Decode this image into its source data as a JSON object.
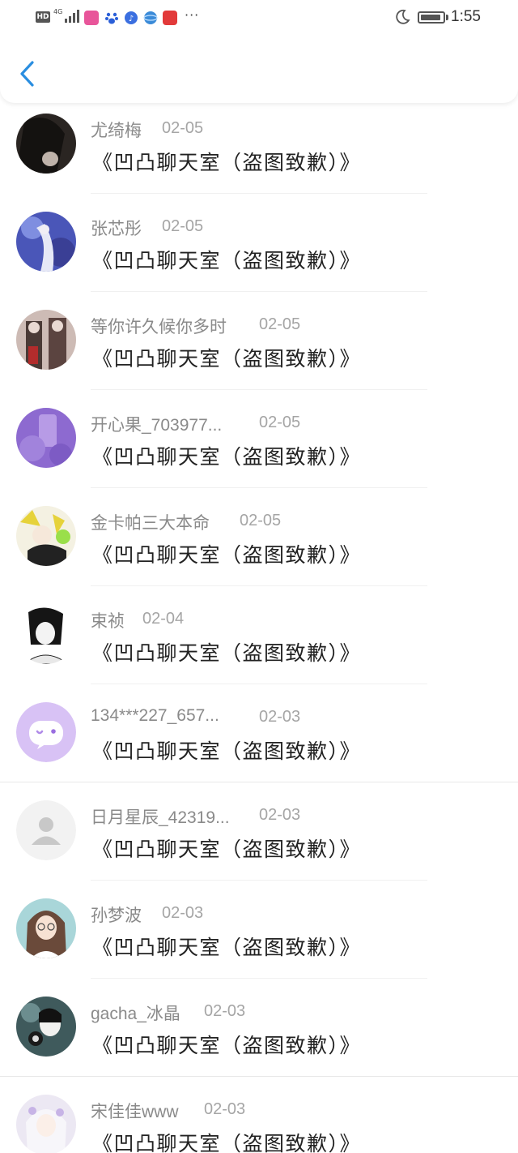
{
  "status_bar": {
    "network_badge": "HD",
    "network_type": "4G",
    "time": "1:55",
    "more_dots": "···"
  },
  "header": {
    "back_icon": "chevron-left-icon"
  },
  "items": [
    {
      "name": "尤绮梅",
      "date": "02-05",
      "title": "《凹凸聊天室（盗图致歉）》"
    },
    {
      "name": "张芯彤",
      "date": "02-05",
      "title": "《凹凸聊天室（盗图致歉）》"
    },
    {
      "name": "等你许久候你多时",
      "date": "02-05",
      "title": "《凹凸聊天室（盗图致歉）》"
    },
    {
      "name": "开心果_703977...",
      "date": "02-05",
      "title": "《凹凸聊天室（盗图致歉）》"
    },
    {
      "name": "金卡帕三大本命",
      "date": "02-05",
      "title": "《凹凸聊天室（盗图致歉）》"
    },
    {
      "name": "束祯",
      "date": "02-04",
      "title": "《凹凸聊天室（盗图致歉）》"
    },
    {
      "name": "134***227_657...",
      "date": "02-03",
      "title": "《凹凸聊天室（盗图致歉）》"
    },
    {
      "name": "日月星辰_42319...",
      "date": "02-03",
      "title": "《凹凸聊天室（盗图致歉）》"
    },
    {
      "name": "孙梦波",
      "date": "02-03",
      "title": "《凹凸聊天室（盗图致歉）》"
    },
    {
      "name": "gacha_冰晶",
      "date": "02-03",
      "title": "《凹凸聊天室（盗图致歉）》"
    },
    {
      "name": "宋佳佳www",
      "date": "02-03",
      "title": "《凹凸聊天室（盗图致歉）》"
    }
  ],
  "colors": {
    "accent": "#2a8ee0",
    "name_text": "#8a8a8a",
    "date_text": "#a5a5a5",
    "title_text": "#222222"
  }
}
